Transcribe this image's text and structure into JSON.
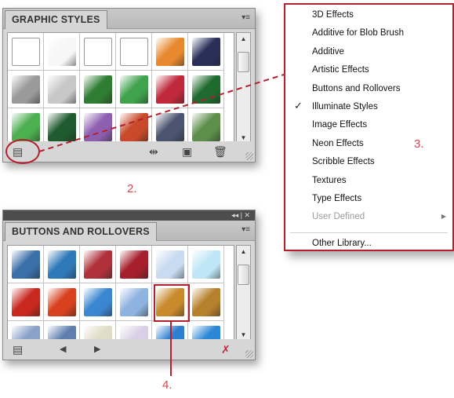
{
  "graphic_styles_panel": {
    "tab_label": "GRAPHIC STYLES",
    "menu_icon": "panel-menu-icon",
    "swatches": [
      "#ffffff",
      "#f7f7f7",
      "#ffffff",
      "#ffffff",
      "#e8892f",
      "#2a2f5a",
      "#9a9a9a",
      "#c8c8c8",
      "#2e7d32",
      "#3fa34d",
      "#c0283b",
      "#1f6b2f",
      "#4caf50",
      "#1e5b2e",
      "#8e5fb0",
      "#c94a2b",
      "#4b5570",
      "#5e8f4a"
    ],
    "footer_icons": [
      "library-menu-icon",
      "break-link-icon",
      "new-style-icon",
      "delete-icon"
    ]
  },
  "buttons_rollovers_panel": {
    "collapse_label": "◂◂ | ✕",
    "tab_label": "BUTTONS AND ROLLOVERS",
    "menu_icon": "panel-menu-icon",
    "swatches": [
      "#3a6fa8",
      "#2f79b8",
      "#b0303a",
      "#a61f2d",
      "#c9dbf1",
      "#bfe6f7",
      "#c8281e",
      "#d8401e",
      "#3a86d0",
      "#8fb3e0",
      "#c98a2c",
      "#b6812c",
      "#8aa1c8",
      "#5f7fb0",
      "#e0dcc8",
      "#d9d0e6",
      "#2f7fd0",
      "#2a86d6"
    ],
    "footer_icons": [
      "library-menu-icon",
      "prev-library-icon",
      "next-library-icon",
      "no-style-icon"
    ]
  },
  "library_menu": {
    "items": [
      {
        "label": "3D Effects",
        "checked": false,
        "disabled": false
      },
      {
        "label": "Additive for Blob Brush",
        "checked": false,
        "disabled": false
      },
      {
        "label": "Additive",
        "checked": false,
        "disabled": false
      },
      {
        "label": "Artistic Effects",
        "checked": false,
        "disabled": false
      },
      {
        "label": "Buttons and Rollovers",
        "checked": false,
        "disabled": false
      },
      {
        "label": "Illuminate Styles",
        "checked": true,
        "disabled": false
      },
      {
        "label": "Image Effects",
        "checked": false,
        "disabled": false
      },
      {
        "label": "Neon Effects",
        "checked": false,
        "disabled": false
      },
      {
        "label": "Scribble Effects",
        "checked": false,
        "disabled": false
      },
      {
        "label": "Textures",
        "checked": false,
        "disabled": false
      },
      {
        "label": "Type Effects",
        "checked": false,
        "disabled": false
      },
      {
        "label": "User Defined",
        "checked": false,
        "disabled": true,
        "submenu": true
      }
    ],
    "other_label": "Other Library...",
    "check_glyph": "✓",
    "submenu_glyph": "▶"
  },
  "callouts": {
    "step2": "2.",
    "step3": "3.",
    "step4": "4."
  },
  "accent_color": "#b5202e"
}
